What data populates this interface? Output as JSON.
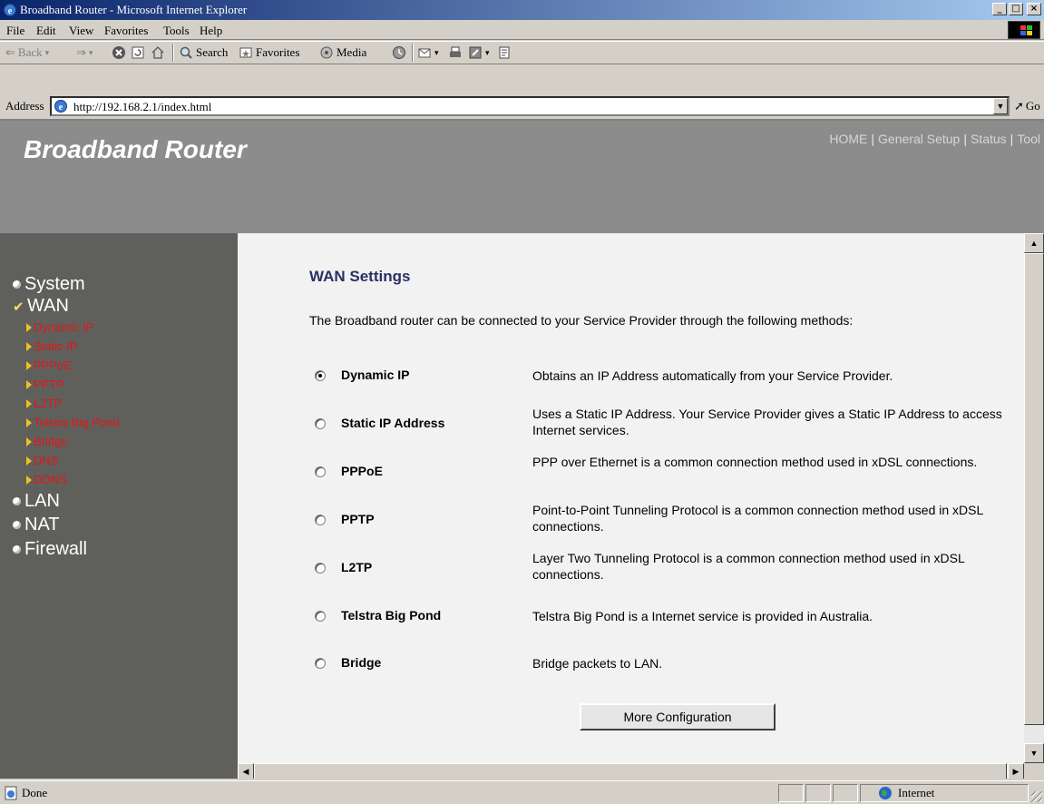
{
  "window": {
    "title": "Broadband Router - Microsoft Internet Explorer",
    "minimize": "_",
    "maximize": "□",
    "close": "×"
  },
  "menu": [
    "File",
    "Edit",
    "View",
    "Favorites",
    "Tools",
    "Help"
  ],
  "toolbar": {
    "back": "Back",
    "search": "Search",
    "favorites": "Favorites",
    "media": "Media"
  },
  "address": {
    "label": "Address",
    "url": "http://192.168.2.1/index.html",
    "go": "Go"
  },
  "page": {
    "brand": "Broadband Router",
    "top_nav": [
      "HOME",
      "General Setup",
      "Status",
      "Tool"
    ],
    "sidebar": {
      "system": "System",
      "wan": "WAN",
      "wan_sub": [
        "Dynamic IP",
        "Static IP",
        "PPPoE",
        "PPTP",
        "L2TP",
        "Telstra Big Pond",
        "Bridge",
        "DNS",
        "DDNS"
      ],
      "lan": "LAN",
      "nat": "NAT",
      "firewall": "Firewall"
    },
    "heading": "WAN Settings",
    "intro": "The Broadband router can be connected to your Service Provider through the following methods:",
    "options": [
      {
        "name": "Dynamic IP",
        "desc": "Obtains an IP Address automatically from your Service Provider.",
        "checked": true
      },
      {
        "name": "Static IP Address",
        "desc": "Uses a Static IP Address. Your Service Provider gives a Static IP Address to access Internet services.",
        "checked": false
      },
      {
        "name": "PPPoE",
        "desc": "PPP over Ethernet is a common connection method used in xDSL connections.",
        "checked": false
      },
      {
        "name": "PPTP",
        "desc": "Point-to-Point Tunneling Protocol is a common connection method used in xDSL connections.",
        "checked": false
      },
      {
        "name": "L2TP",
        "desc": "Layer Two Tunneling Protocol is a common connection method used in xDSL connections.",
        "checked": false
      },
      {
        "name": "Telstra Big Pond",
        "desc": "Telstra Big Pond is a Internet service is provided in Australia.",
        "checked": false
      },
      {
        "name": "Bridge",
        "desc": "Bridge packets to LAN.",
        "checked": false
      }
    ],
    "more_button": "More Configuration"
  },
  "status": {
    "text": "Done",
    "zone": "Internet"
  },
  "colors": {
    "header_bg": "#8c8c8c",
    "sidebar_bg": "#5f605c",
    "sub_link": "#e81414",
    "heading": "#2b2f66"
  }
}
